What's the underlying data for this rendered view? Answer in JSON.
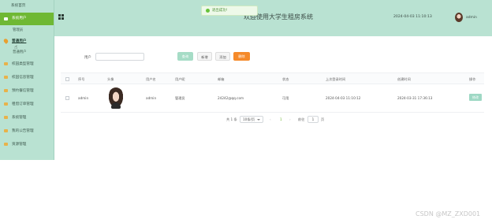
{
  "sidebar": {
    "home": "系统首页",
    "items": [
      {
        "label": "系统用户",
        "sub": "管理员"
      },
      {
        "label": "普通用户",
        "sub": "普通用户"
      },
      {
        "label": "校园类型管理"
      },
      {
        "label": "校园信息管理"
      },
      {
        "label": "预约餐信管理"
      },
      {
        "label": "租借订单管理"
      },
      {
        "label": "系统管理"
      },
      {
        "label": "我的公告管理"
      },
      {
        "label": "资源管理"
      }
    ]
  },
  "header": {
    "title": "欢迎使用大学生租房系统",
    "datetime": "2024-04-03 11:10:13",
    "user": "admin"
  },
  "toast": {
    "message": "退出成功!"
  },
  "search": {
    "label": "用户",
    "placeholder": ""
  },
  "toolbar": {
    "search": "查询",
    "add": "新增",
    "delete": "添加",
    "export": "删除"
  },
  "table": {
    "headers": [
      "序号",
      "头像",
      "用户名",
      "用户昵",
      "邮箱",
      "状态",
      "上次登录时间",
      "创建时间",
      "操作"
    ],
    "rows": [
      {
        "index": "admin",
        "username": "admin",
        "nickname": "管理员",
        "email": "24242@qq.com",
        "status": "可用",
        "last_login": "2024-04-03 11:10:12",
        "created": "2024-03-31 17:36:13",
        "action": "修改"
      }
    ]
  },
  "pagination": {
    "total": "共 1 条",
    "page_size": "10条/页",
    "current": "1",
    "goto_label": "前往",
    "goto_value": "1",
    "page_unit": "页"
  },
  "watermark": "CSDN @MZ_ZXD001",
  "colors": {
    "accent": "#b9e2d2",
    "active": "#6fb834",
    "export": "#f58a2a",
    "search_btn": "#a6dcc6"
  }
}
